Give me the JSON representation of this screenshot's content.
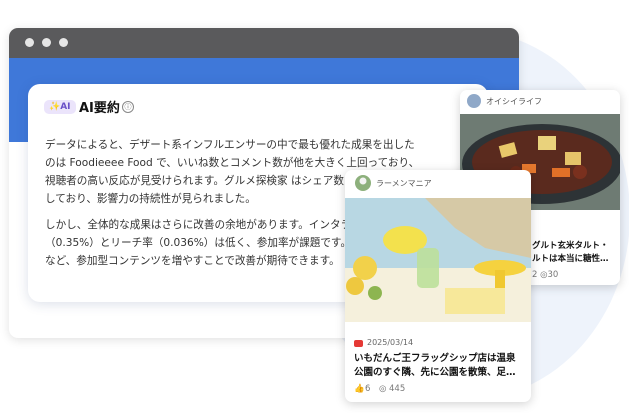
{
  "summary": {
    "badge": "✨AI",
    "title": "AI要約",
    "info_icon": "ⓘ",
    "paragraph1": "データによると、デザート系インフルエンサーの中で最も優れた成果を出した\nのは Foodieeee Food で、いいね数とコメント数が他を大きく上回っており、\n視聴者の高い反応が見受けられます。グルメ探検家 はシェア数と\nしており、影響力の持続性が見られました。",
    "paragraph2": "しかし、全体的な成果はさらに改善の余地があります。インタラ\n（0.35%）とリーチ率（0.036%）は低く、参加率が課題です。\nなど、参加型コンテンツを増やすことで改善が期待できます。"
  },
  "post_back": {
    "author": "オイシイライフ",
    "title_partial": "グルト玄米タルト・\nルトは本当に糖性…",
    "stats_partial": "2  ◎30"
  },
  "post_front": {
    "author": "ラーメンマニア",
    "date": "2025/03/14",
    "title": "いもだんご王フラッグシップ店は温泉\n公園のすぐ隣、先に公園を散策、足…",
    "likes": "6",
    "views": "445"
  },
  "colors": {
    "accent": "#3f78d9",
    "titlebar": "#5a5a5c",
    "badge_bg": "#ebe4fb"
  }
}
